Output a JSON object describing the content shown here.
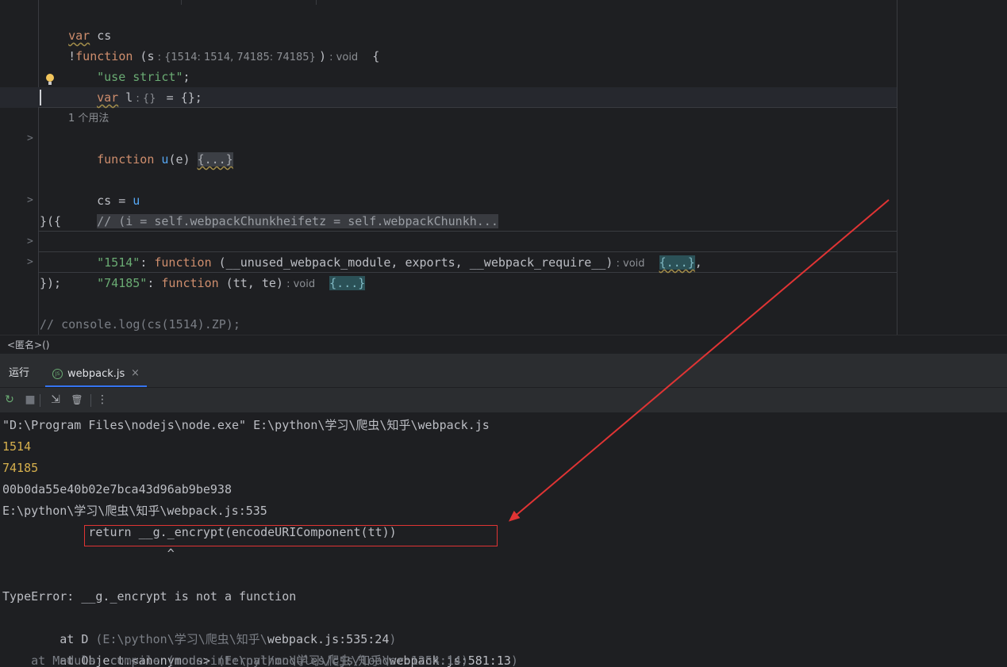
{
  "editor": {
    "line1": {
      "kw": "var",
      "name": " cs"
    },
    "line2": {
      "bang": "!",
      "kw": "function",
      "open": " (s",
      "hint": " : {1514: 1514, 74185: 74185} ",
      "close": ")",
      "ret_hint": " : void",
      "brace": "  {"
    },
    "line3": {
      "str": "\"use strict\"",
      "semi": ";"
    },
    "line4": {
      "kw": "var",
      "name": " l",
      "hint": " : {} ",
      "rest": " = {};"
    },
    "usage": "1 个用法",
    "line6": {
      "kw": "function",
      "name": " u",
      "args": "(e) ",
      "fold": "{...}"
    },
    "line7": {
      "a": "cs = ",
      "u": "u"
    },
    "line8": {
      "comment": "// (i = self.webpackChunkheifetz = self.webpackChunkh..."
    },
    "line9": "}({",
    "line10": {
      "key": "\"1514\"",
      "colon": ": ",
      "kw": "function",
      "args": " (__unused_webpack_module, exports, __webpack_require__)",
      "hint": " : void",
      "fold": "{...}",
      "tail": ","
    },
    "line11": {
      "key": "\"74185\"",
      "colon": ": ",
      "kw": "function",
      "args": " (tt, te)",
      "hint": " : void",
      "fold": "{...}"
    },
    "line12": "});",
    "line13": "// console.log(cs(1514).ZP);"
  },
  "breadcrumb": "<匿名>()",
  "run_panel": {
    "title": "运行",
    "tab_label": "webpack.js",
    "tab_close": "×",
    "tab_icon": "JS"
  },
  "toolbar": {
    "rerun": "↻",
    "stop": "■",
    "scroll": "⇲",
    "trash": "🗑",
    "more": "⋮"
  },
  "console": {
    "cmd": "\"D:\\Program Files\\nodejs\\node.exe\" E:\\python\\学习\\爬虫\\知乎\\webpack.js",
    "out1": "1514",
    "out2": "74185",
    "out3": "00b0da55e40b02e7bca43d96ab9be938",
    "err_loc": "E:\\python\\学习\\爬虫\\知乎\\webpack.js:535",
    "err_code": "            return __g._encrypt(encodeURIComponent(tt))",
    "err_caret": "                       ^",
    "err_type": "TypeError: __g._encrypt is not a function",
    "st1_pre": "    at D ",
    "st1_open": "(E:\\python\\学习\\爬虫\\知乎\\",
    "st1_file": "webpack.js:535:24",
    "st1_close": ")",
    "st2_pre": "    at Object.<anonymous> ",
    "st2_open": "(E:\\python\\学习\\爬虫\\知乎\\",
    "st2_file": "webpack.js:581:13",
    "st2_close": ")",
    "st3": "    at Module._compile (node:internal/modules/cjs/loader:1254:14)"
  },
  "colors": {
    "annotation_red": "#e03434",
    "keyword": "#cf8e6d",
    "string": "#6aab73",
    "number_output": "#d6b04d"
  }
}
